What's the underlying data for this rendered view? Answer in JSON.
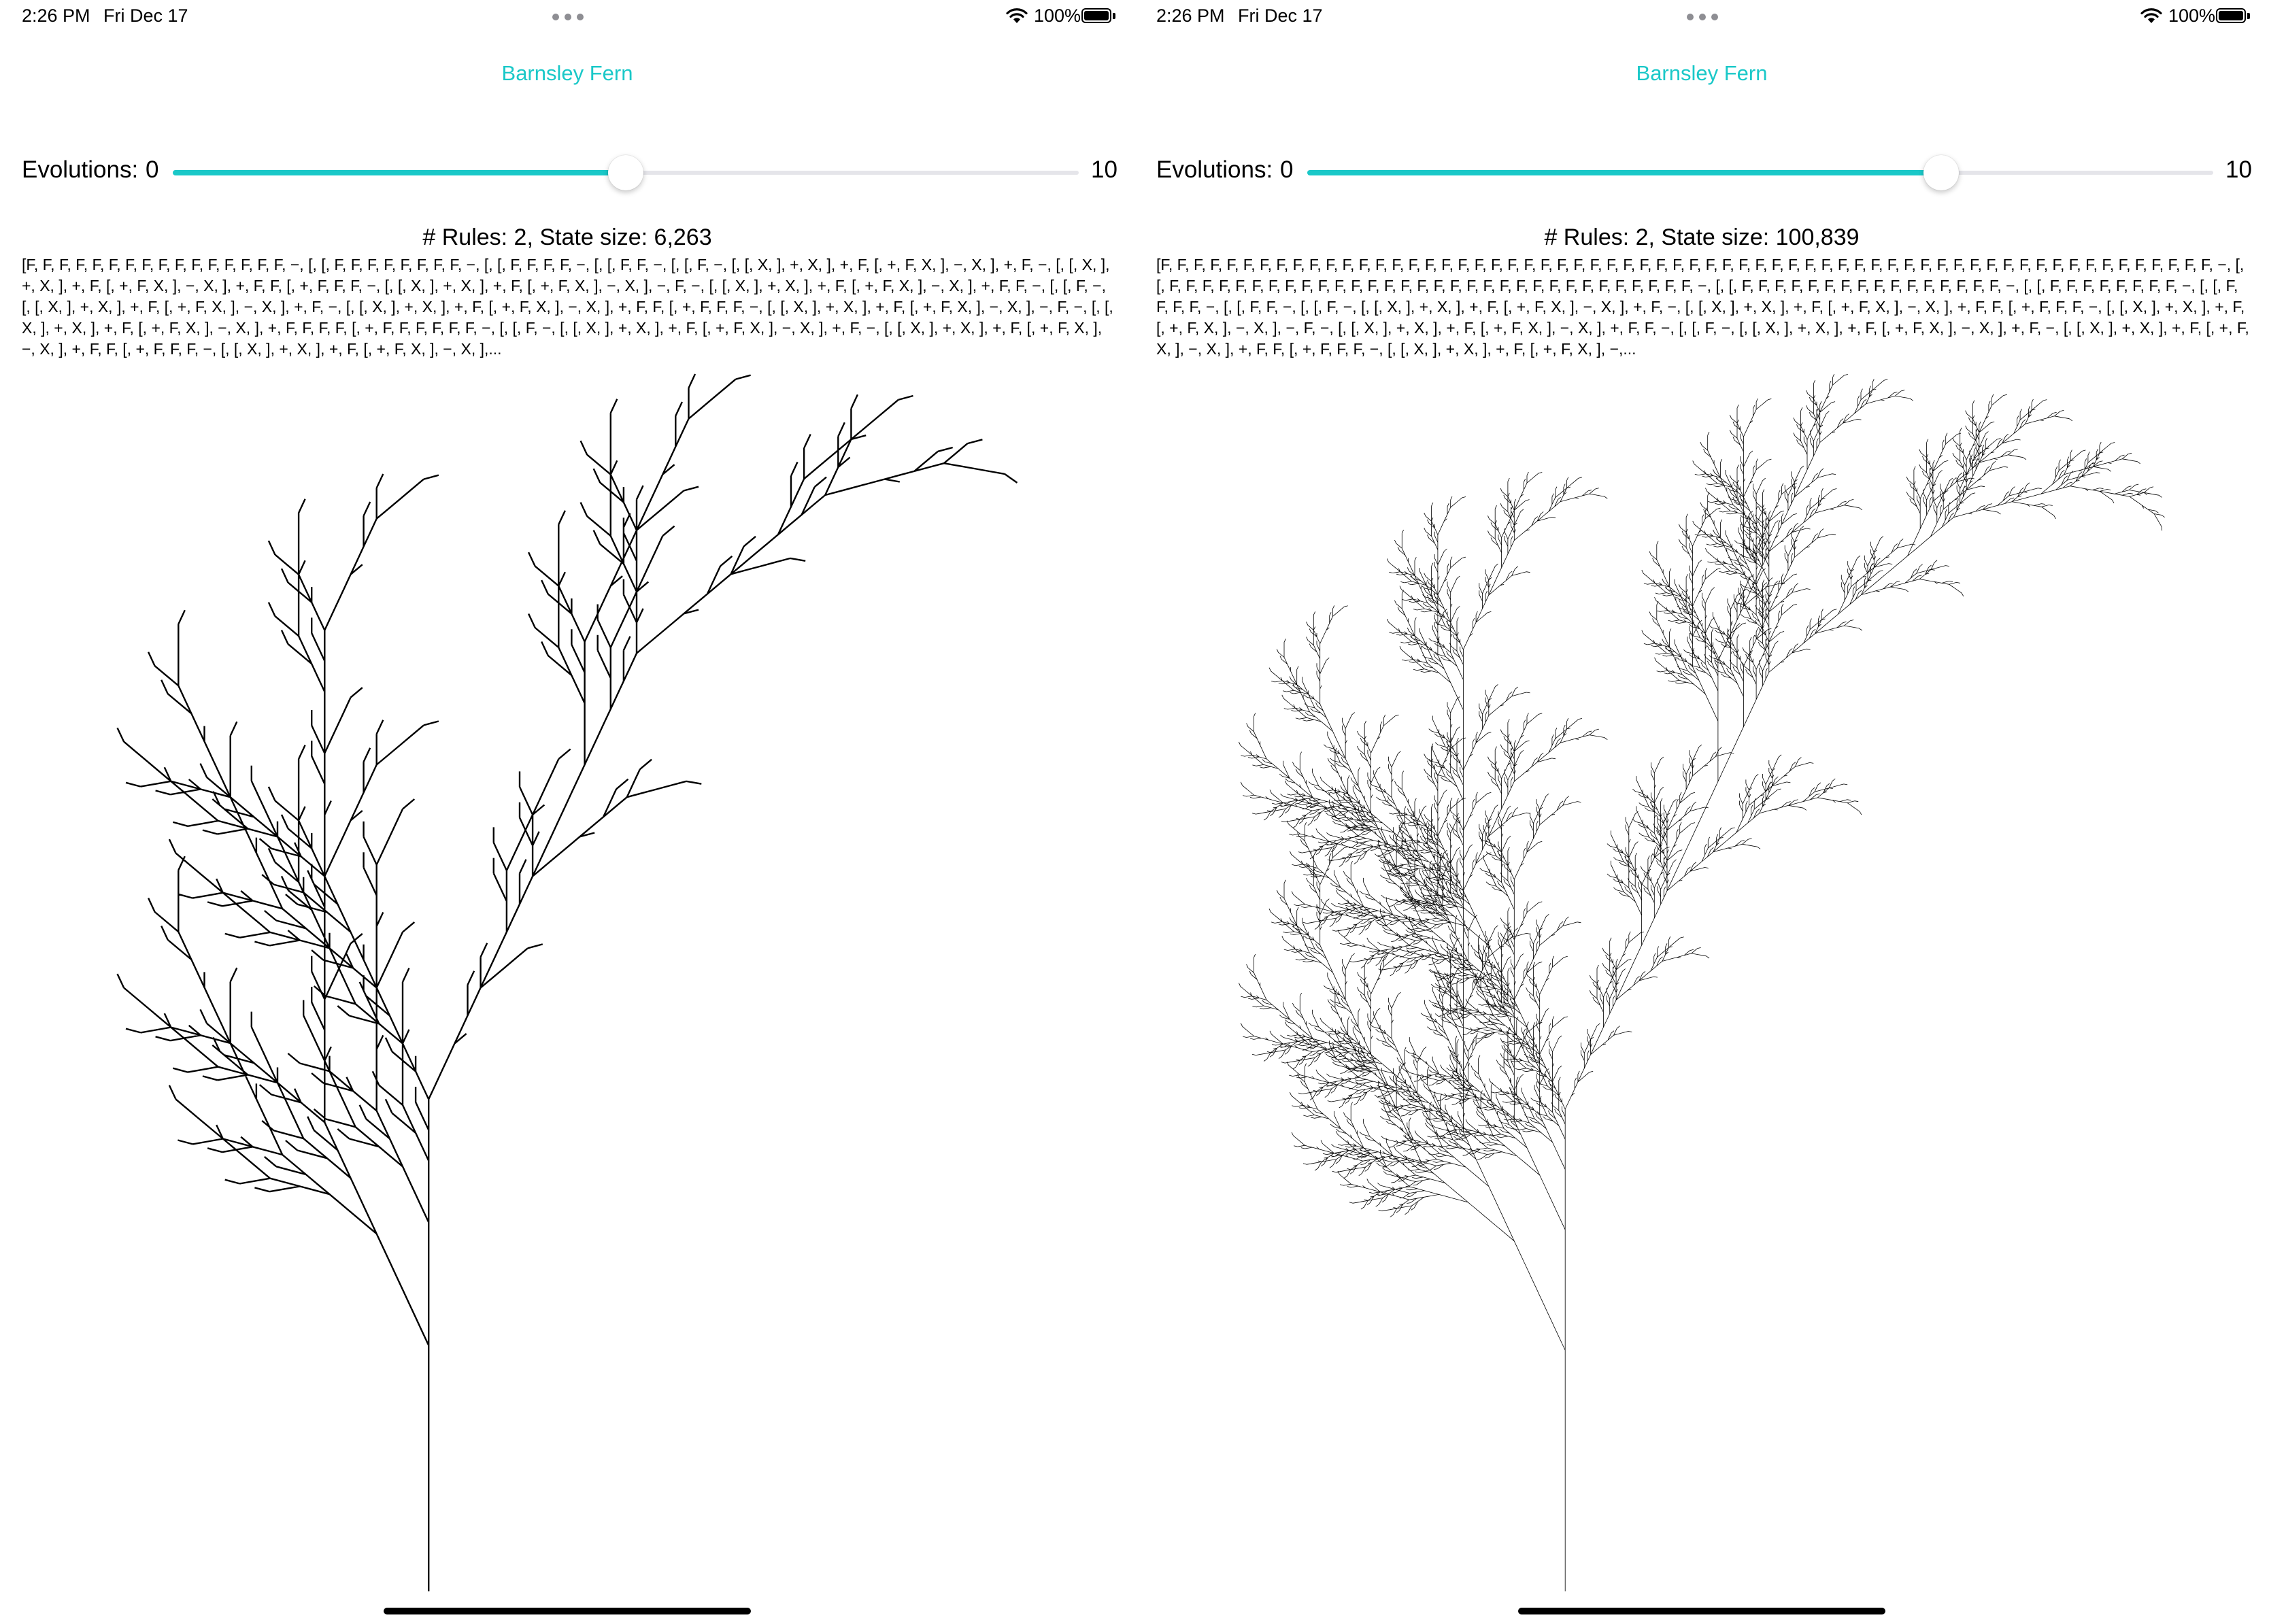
{
  "status_bar": {
    "time": "2:26 PM",
    "date": "Fri Dec 17",
    "battery_percent": "100%"
  },
  "accent_color": "#1ac8c8",
  "panels": [
    {
      "nav_title": "Barnsley Fern",
      "evolutions_label": "Evolutions:",
      "slider": {
        "min_label": "0",
        "max_label": "10",
        "min": 0,
        "max": 10,
        "value": 5
      },
      "summary": "# Rules: 2, State size: 6,263",
      "state_text": "[F, F, F, F, F, F, F, F, F, F, F, F, F, F, F, F, −, [, [, F, F, F, F, F, F, F, F, −, [, [, F, F, F, F, −, [, [, F, F, −, [, [, F, −, [, [, X, ], +, X, ], +, F, [, +, F, X, ], −, X, ], +, F, −, [, [, X, ], +, X, ], +, F, [, +, F, X, ], −, X, ], +, F, F, [, +, F, F, F, −, [, [, X, ], +, X, ], +, F, [, +, F, X, ], −, X, ], −, F, −, [, [, X, ], +, X, ], +, F, [, +, F, X, ], −, X, ], +, F, F, −, [, [, F, −, [, [, X, ], +, X, ], +, F, [, +, F, X, ], −, X, ], +, F, −, [, [, X, ], +, X, ], +, F, [, +, F, X, ], −, X, ], +, F, F, [, +, F, F, F, −, [, [, X, ], +, X, ], +, F, [, +, F, X, ], −, X, ], −, F, −, [, [, X, ], +, X, ], +, F, [, +, F, X, ], −, X, ], +, F, F, F, F, [, +, F, F, F, F, F, F, −, [, [, F, −, [, [, X, ], +, X, ], +, F, [, +, F, X, ], −, X, ], +, F, −, [, [, X, ], +, X, ], +, F, [, +, F, X, ], −, X, ], +, F, F, [, +, F, F, F, −, [, [, X, ], +, X, ], +, F, [, +, F, X, ], −, X, ],..."
    },
    {
      "nav_title": "Barnsley Fern",
      "evolutions_label": "Evolutions:",
      "slider": {
        "min_label": "0",
        "max_label": "10",
        "min": 0,
        "max": 10,
        "value": 7
      },
      "summary": "# Rules: 2, State size: 100,839",
      "state_text": "[F, F, F, F, F, F, F, F, F, F, F, F, F, F, F, F, F, F, F, F, F, F, F, F, F, F, F, F, F, F, F, F, F, F, F, F, F, F, F, F, F, F, F, F, F, F, F, F, F, F, F, F, F, F, F, F, F, F, F, F, F, F, F, F, −, [, [, F, F, F, F, F, F, F, F, F, F, F, F, F, F, F, F, F, F, F, F, F, F, F, F, F, F, F, F, F, F, F, F, −, [, [, F, F, F, F, F, F, F, F, F, F, F, F, F, F, F, F, −, [, [, F, F, F, F, F, F, F, F, −, [, [, F, F, F, F, −, [, [, F, F, −, [, [, F, −, [, [, X, ], +, X, ], +, F, [, +, F, X, ], −, X, ], +, F, −, [, [, X, ], +, X, ], +, F, [, +, F, X, ], −, X, ], +, F, F, [, +, F, F, F, −, [, [, X, ], +, X, ], +, F, [, +, F, X, ], −, X, ], −, F, −, [, [, X, ], +, X, ], +, F, [, +, F, X, ], −, X, ], +, F, F, −, [, [, F, −, [, [, X, ], +, X, ], +, F, [, +, F, X, ], −, X, ], +, F, −, [, [, X, ], +, X, ], +, F, [, +, F, X, ], −, X, ], +, F, F, [, +, F, F, F, −, [, [, X, ], +, X, ], +, F, [, +, F, X, ], −,..."
    }
  ]
}
